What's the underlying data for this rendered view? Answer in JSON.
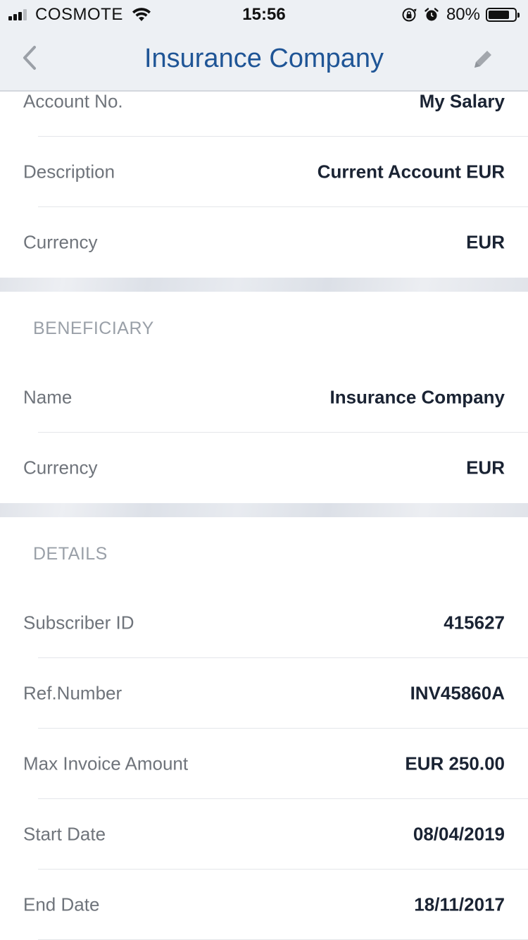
{
  "status_bar": {
    "carrier": "COSMOTE",
    "time": "15:56",
    "battery_percent": "80%",
    "battery_level": 0.8,
    "signal_bars_filled": 3,
    "signal_bars_total": 4
  },
  "nav": {
    "title": "Insurance Company",
    "back_icon": "chevron-left-icon",
    "edit_icon": "pencil-icon"
  },
  "account": {
    "rows": [
      {
        "label": "Account No.",
        "value": "My Salary"
      },
      {
        "label": "Description",
        "value": "Current Account EUR"
      },
      {
        "label": "Currency",
        "value": "EUR"
      }
    ]
  },
  "beneficiary": {
    "header": "BENEFICIARY",
    "rows": [
      {
        "label": "Name",
        "value": "Insurance Company"
      },
      {
        "label": "Currency",
        "value": "EUR"
      }
    ]
  },
  "details": {
    "header": "DETAILS",
    "rows": [
      {
        "label": "Subscriber ID",
        "value": "415627"
      },
      {
        "label": "Ref.Number",
        "value": "INV45860A"
      },
      {
        "label": "Max Invoice Amount",
        "value": "EUR 250.00"
      },
      {
        "label": "Start Date",
        "value": "08/04/2019"
      },
      {
        "label": "End Date",
        "value": "18/11/2017"
      }
    ]
  },
  "colors": {
    "title_blue": "#1f5596",
    "label_gray": "#6f747b",
    "value_dark": "#1a2333",
    "section_gray": "#9aa0a8"
  }
}
